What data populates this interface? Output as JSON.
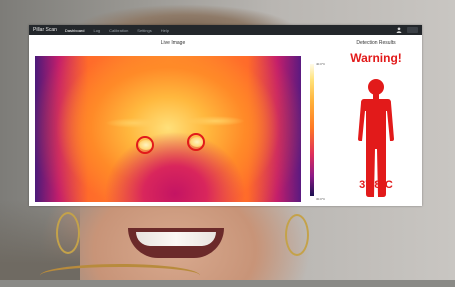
{
  "navbar": {
    "brand": "Pillar Scan",
    "links": [
      "Dashboard",
      "Log",
      "Calibration",
      "Settings",
      "Help"
    ],
    "active_index": 0
  },
  "live_panel": {
    "title": "Live Image",
    "scale_max": "40.0°C",
    "scale_min": "30.0°C"
  },
  "result_panel": {
    "title": "Detection Results",
    "warning": "Warning!",
    "temperature": "37,8°C"
  },
  "icons": {
    "user": "user-icon",
    "body": "human-body-icon"
  },
  "colors": {
    "alert": "#e21a1a",
    "navbar": "#23272b"
  }
}
